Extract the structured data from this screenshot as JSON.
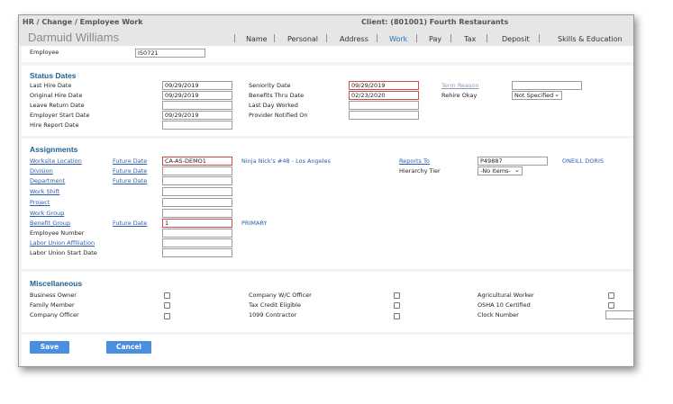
{
  "header": {
    "breadcrumb": "HR / Change / Employee Work",
    "client": "Client: (801001) Fourth Restaurants",
    "employee_name": "Darmuid Williams",
    "tabs": [
      "Name",
      "Personal",
      "Address",
      "Work",
      "Pay",
      "Tax",
      "Deposit",
      "Skills & Education"
    ],
    "active_tab": "Work",
    "separator": "|"
  },
  "employee": {
    "label": "Employee",
    "value": "I50721"
  },
  "status_dates": {
    "heading": "Status Dates",
    "last_hire_date": {
      "label": "Last Hire Date",
      "value": "09/29/2019"
    },
    "original_hire_date": {
      "label": "Original Hire Date",
      "value": "09/29/2019"
    },
    "leave_return_date": {
      "label": "Leave Return Date",
      "value": ""
    },
    "employer_start_date": {
      "label": "Employer Start Date",
      "value": "09/29/2019"
    },
    "hire_report_date": {
      "label": "Hire Report Date",
      "value": ""
    },
    "seniority_date": {
      "label": "Seniority Date",
      "value": "09/29/2019"
    },
    "benefits_thru_date": {
      "label": "Benefits Thru Date",
      "value": "02/23/2020"
    },
    "last_day_worked": {
      "label": "Last Day Worked",
      "value": ""
    },
    "provider_notified_on": {
      "label": "Provider Notified On",
      "value": ""
    },
    "term_reason": {
      "label": "Term Reason",
      "value": ""
    },
    "rehire_okay": {
      "label": "Rehire Okay",
      "value": "Not Specified"
    }
  },
  "assignments": {
    "heading": "Assignments",
    "future_date_label": "Future Date",
    "worksite_location": {
      "label": "Worksite Location",
      "value": "CA-AS-DEMO1",
      "description": "Ninja Nick's #48 - Los Angeles"
    },
    "division": {
      "label": "Division",
      "value": ""
    },
    "department": {
      "label": "Department",
      "value": ""
    },
    "work_shift": {
      "label": "Work Shift",
      "value": ""
    },
    "project": {
      "label": "Project",
      "value": ""
    },
    "work_group": {
      "label": "Work Group",
      "value": ""
    },
    "benefit_group": {
      "label": "Benefit Group",
      "value": "1",
      "description": "PRIMARY"
    },
    "employee_number": {
      "label": "Employee Number",
      "value": ""
    },
    "labor_union_affiliation": {
      "label": "Labor Union Affiliation",
      "value": ""
    },
    "labor_union_start_date": {
      "label": "Labor Union Start Date",
      "value": ""
    },
    "reports_to": {
      "label": "Reports To",
      "value": "P49887",
      "description": "ONEILL DORIS"
    },
    "hierarchy_tier": {
      "label": "Hierarchy Tier",
      "value": "-No Items-"
    }
  },
  "miscellaneous": {
    "heading": "Miscellaneous",
    "business_owner": "Business Owner",
    "family_member": "Family Member",
    "company_officer": "Company Officer",
    "company_wc_officer": "Company W/C Officer",
    "tax_credit_eligible": "Tax Credit Eligible",
    "contractor_1099": "1099 Contractor",
    "agricultural_worker": "Agricultural Worker",
    "osha_10_certified": "OSHA 10 Certified",
    "clock_number": {
      "label": "Clock Number",
      "value": ""
    }
  },
  "actions": {
    "save": "Save",
    "cancel": "Cancel"
  },
  "colors": {
    "accent_blue": "#4a8ee0",
    "link_blue": "#2a5db0",
    "heading_blue": "#1f5f8f",
    "required_red": "#d04848"
  }
}
